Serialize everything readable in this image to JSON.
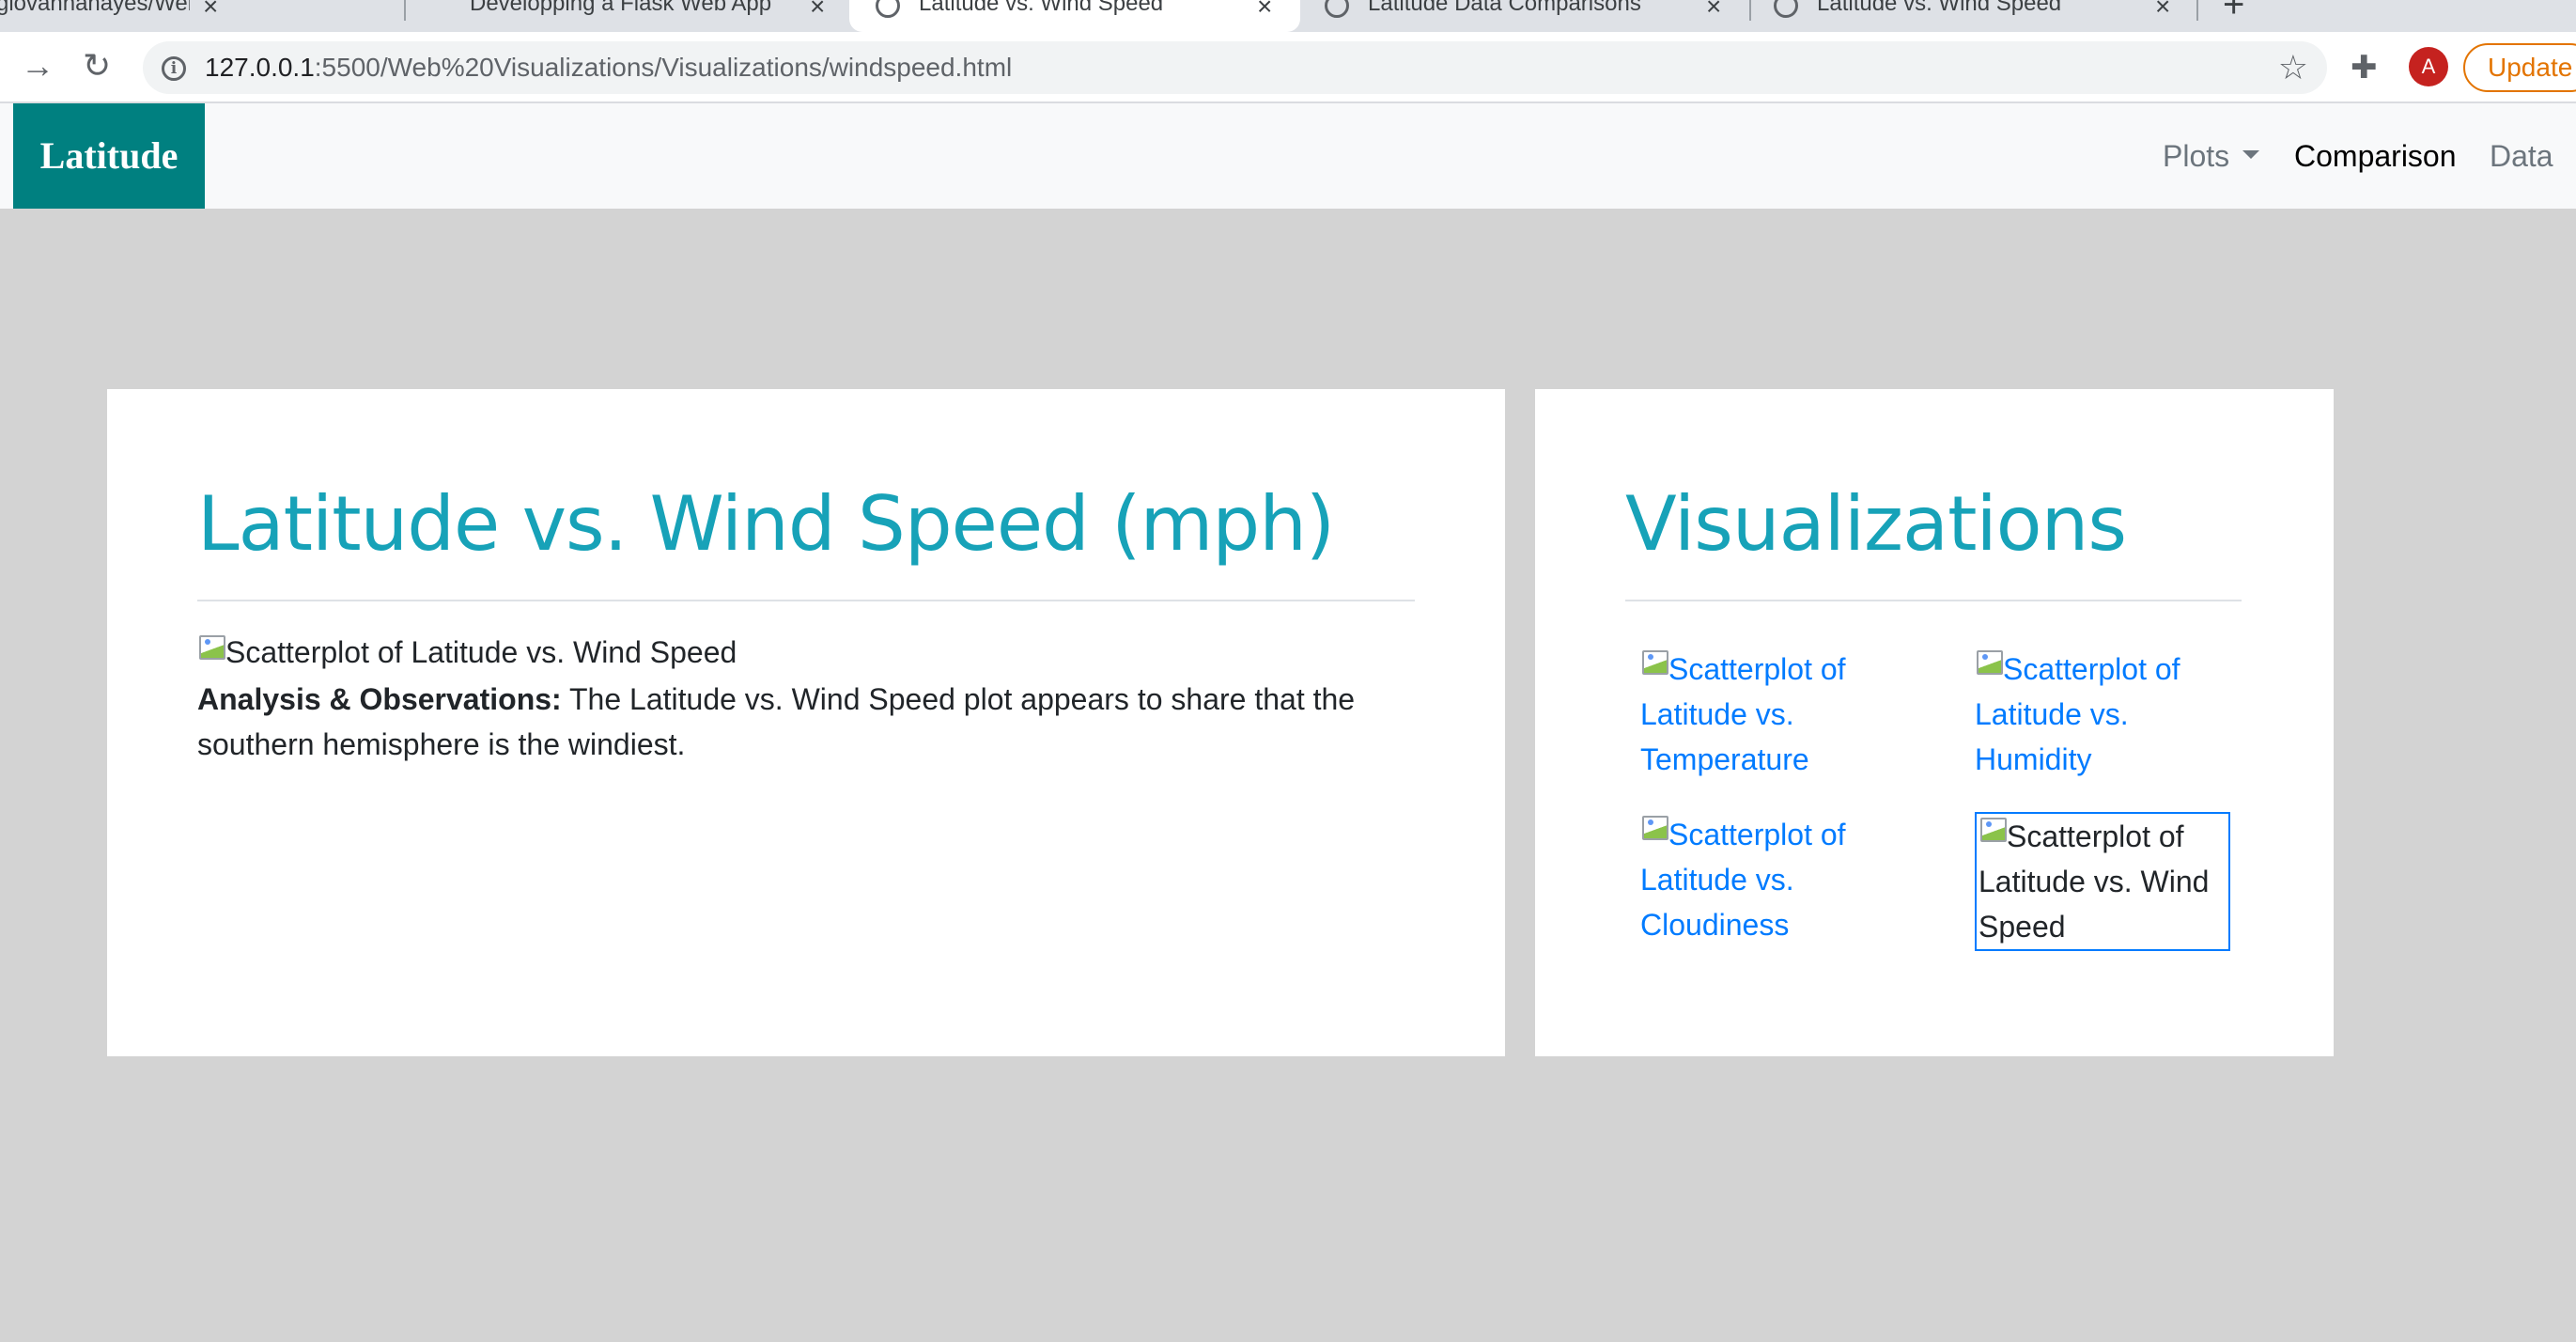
{
  "browser": {
    "tabs": [
      {
        "title": "giovannahayes/Web-Design-Ch",
        "active": false
      },
      {
        "title": "Developping a Flask Web App",
        "active": false
      },
      {
        "title": "Latitude vs. Wind Speed",
        "active": true
      },
      {
        "title": "Latitude Data Comparisons",
        "active": false
      },
      {
        "title": "Latitude vs. Wind Speed",
        "active": false
      }
    ],
    "url_host": "127.0.0.1",
    "url_path": ":5500/Web%20Visualizations/Visualizations/windspeed.html",
    "avatar_letter": "A",
    "update_label": "Update"
  },
  "navbar": {
    "brand": "Latitude",
    "plots_label": "Plots",
    "comparison_label": "Comparison",
    "data_label": "Data"
  },
  "main": {
    "title": "Latitude vs. Wind Speed (mph)",
    "image_alt": "Scatterplot of Latitude vs. Wind Speed",
    "analysis_label": "Analysis & Observations:",
    "analysis_text": " The Latitude vs. Wind Speed plot appears to share that the southern hemisphere is the windiest."
  },
  "sidebar": {
    "title": "Visualizations",
    "thumbnails": [
      {
        "alt": "Scatterplot of Latitude vs. Temperature"
      },
      {
        "alt": "Scatterplot of Latitude vs. Humidity"
      },
      {
        "alt": "Scatterplot of Latitude vs. Cloudiness"
      },
      {
        "alt": "Scatterplot of Latitude vs. Wind Speed"
      }
    ]
  },
  "colors": {
    "brand_bg": "#008080",
    "heading": "#17a2b8",
    "link": "#007bff",
    "page_bg": "#d3d3d3"
  }
}
